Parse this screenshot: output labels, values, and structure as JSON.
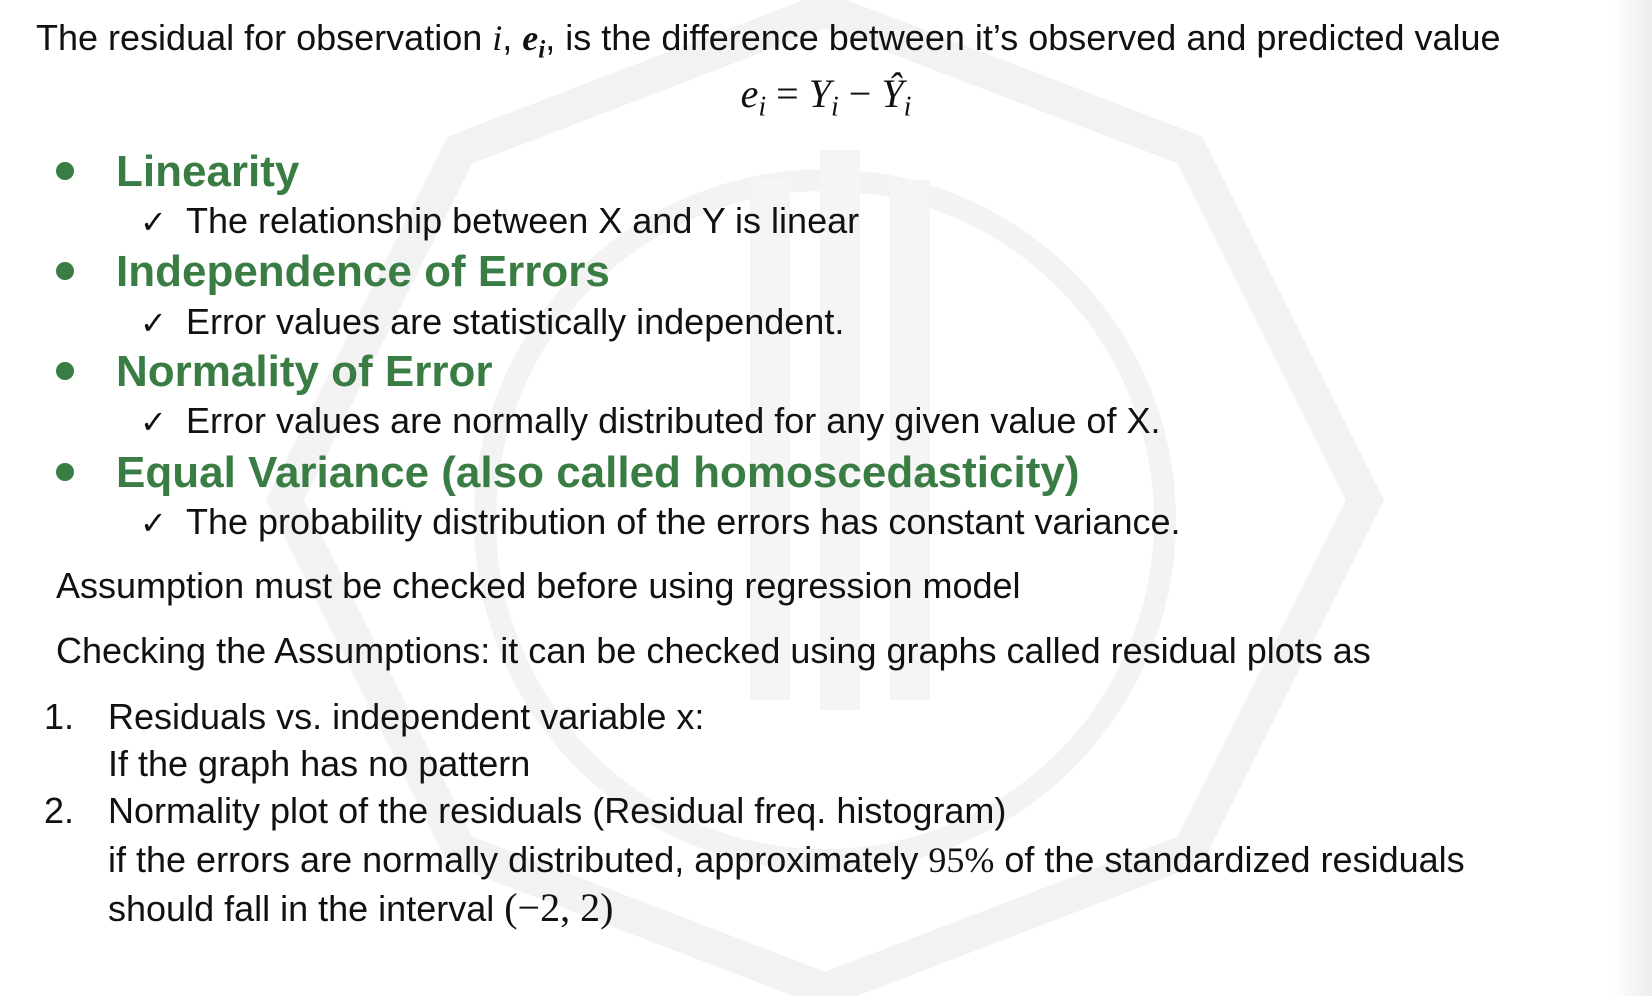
{
  "intro": {
    "text_a": "The residual for observation ",
    "var_i": "i",
    "sep": ", ",
    "var_e": "e",
    "sub_i": "i",
    "text_b": ", is the difference between it’s observed and predicted value"
  },
  "formula": {
    "lhs_var": "e",
    "lhs_sub": "i",
    "eq": " = ",
    "y_var": "Y",
    "y_sub": "i",
    "minus": " − ",
    "yhat_var": "Ŷ",
    "yhat_sub": "i"
  },
  "assumptions": [
    {
      "title": "Linearity",
      "detail": "The relationship between X and Y is linear"
    },
    {
      "title": "Independence of Errors",
      "detail": "Error values are statistically independent."
    },
    {
      "title": "Normality of Error",
      "detail": "Error values are normally distributed for any given value of X."
    },
    {
      "title": "Equal Variance (also called homoscedasticity)",
      "detail": "The probability distribution of the errors has constant variance."
    }
  ],
  "check_mark": "✓",
  "note_1": "Assumption must be checked before using regression model",
  "note_2": "Checking the Assumptions: it can be checked using graphs called residual plots as",
  "steps": [
    {
      "num": "1.",
      "title": "Residuals vs. independent variable x:",
      "detail": "If the graph has no pattern"
    },
    {
      "num": "2.",
      "title": "Normality plot of the residuals (Residual freq. histogram)",
      "detail_a": "if the errors are normally distributed, approximately ",
      "detail_pct": "95%",
      "detail_b": " of the standardized residuals",
      "detail_c": "should fall in the interval ",
      "interval": "(−2, 2)"
    }
  ],
  "colors": {
    "heading_green": "#3a7d44",
    "text": "#111111"
  }
}
